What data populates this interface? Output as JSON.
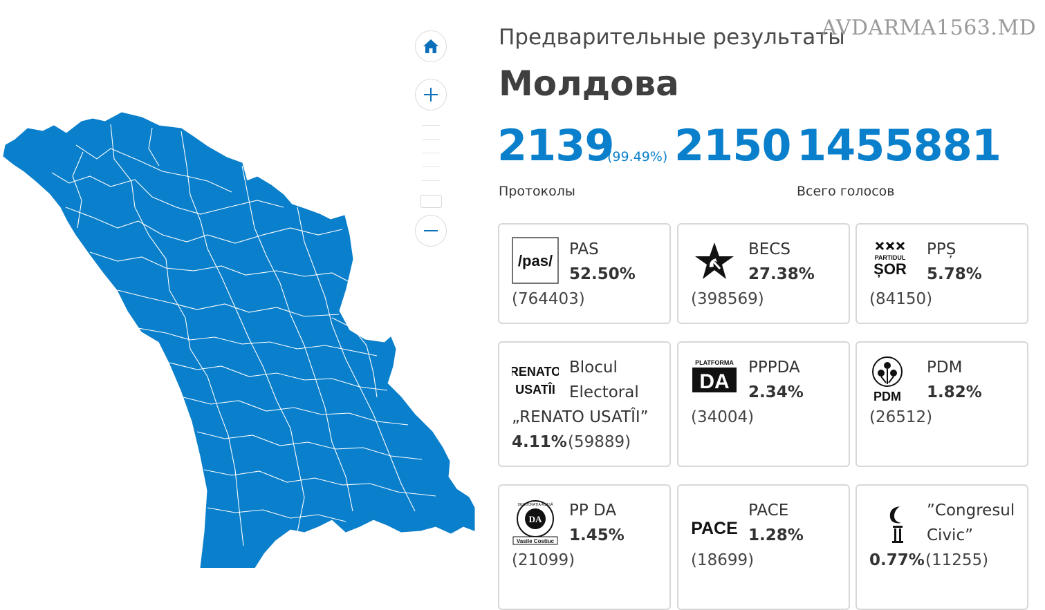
{
  "watermark": "AVDARMA1563.MD",
  "header": {
    "subtitle": "Предварительные результаты",
    "title": "Молдова"
  },
  "stats": {
    "protocols_counted": "2139",
    "protocols_percent": "(99.49%)",
    "protocols_total": "2150",
    "total_votes": "1455881",
    "protocols_label": "Протоколы",
    "votes_label": "Всего голосов"
  },
  "map": {
    "fill_color": "#0a7fcb",
    "border_color": "#ffffff",
    "controls": [
      "home-icon",
      "zoom-in-icon",
      "zoom-out-icon"
    ]
  },
  "parties": [
    {
      "name": "PAS",
      "percent": "52.50%",
      "votes": "(764403)",
      "logo": "pas-logo"
    },
    {
      "name": "BECS",
      "percent": "27.38%",
      "votes": "(398569)",
      "logo": "star-hammer-sickle-logo"
    },
    {
      "name": "PPȘ",
      "percent": "5.78%",
      "votes": "(84150)",
      "logo": "partidul-sor-logo",
      "logo_text": "PARTIDUL",
      "logo_text2": "ȘOR"
    },
    {
      "name_line1": "Blocul",
      "name_line2": "Electoral",
      "name_line3": "„RENATO USATÎI”",
      "percent": "4.11%",
      "votes": "(59889)",
      "logo": "renato-usatii-logo",
      "logo_text": "RENATO",
      "logo_text2": "USATÎI"
    },
    {
      "name": "PPPDA",
      "percent": "2.34%",
      "votes": "(34004)",
      "logo": "platforma-da-logo",
      "logo_text": "PLATFORMA",
      "logo_text2": "DA"
    },
    {
      "name": "PDM",
      "percent": "1.82%",
      "votes": "(26512)",
      "logo": "pdm-rose-logo",
      "logo_text": "PDM"
    },
    {
      "name": "PP DA",
      "percent": "1.45%",
      "votes": "(21099)",
      "logo": "democratia-acasa-logo",
      "logo_text": "DEMOCRAȚIA ACASĂ",
      "logo_text2": "DA",
      "logo_text3": "Vasile Costiuc"
    },
    {
      "name": "PACE",
      "percent": "1.28%",
      "votes": "(18699)",
      "logo": "pace-logo",
      "logo_text": "PACE"
    },
    {
      "name_line1": "”Congresul",
      "name_line2": "Civic”",
      "percent": "0.77%",
      "votes": "(11255)",
      "logo": "congresul-civic-logo"
    }
  ]
}
